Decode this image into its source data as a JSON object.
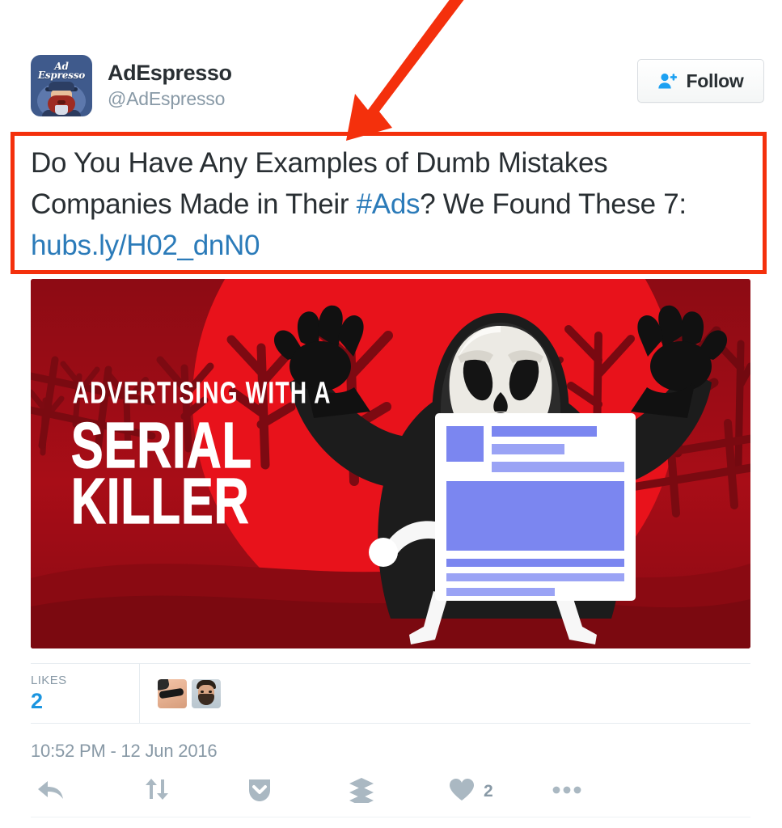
{
  "account": {
    "display_name": "AdEspresso",
    "handle": "@AdEspresso",
    "avatar_line1": "Ad",
    "avatar_line2": "Espresso",
    "avatar_alt": "adespresso-logo-barista"
  },
  "follow_button": {
    "label": "Follow",
    "icon": "user-plus-icon"
  },
  "tweet": {
    "text_part1": "Do You Have Any Examples of Dumb Mistakes Companies Made in Their ",
    "hashtag": "#Ads",
    "text_part2": "? We Found These 7: ",
    "link": "hubs.ly/H02_dnN0",
    "full_text": "Do You Have Any Examples of Dumb Mistakes Companies Made in Their #Ads? We Found These 7: hubs.ly/H02_dnN0",
    "timestamp": "10:52 PM - 12 Jun 2016"
  },
  "media": {
    "headline_small": "ADVERTISING WITH A",
    "headline_line1": "SERIAL",
    "headline_line2": "KILLER",
    "alt": "ghost-face-killer-holding-facebook-ad-card",
    "bg_color": "#a80d17",
    "accent_red": "#e8121b",
    "card_blue": "#7b86f0"
  },
  "likes": {
    "label": "LIKES",
    "count": "2",
    "liker_avatars": [
      "liker-avatar-1",
      "liker-avatar-2"
    ]
  },
  "actions": {
    "reply": "reply-icon",
    "retweet": "retweet-icon",
    "pocket": "pocket-save-icon",
    "buffer": "buffer-icon",
    "like": "like-heart-icon",
    "like_count": "2",
    "more": "more-options-icon"
  },
  "annotation": {
    "box_color": "#f4300c",
    "arrow_color": "#f4300c",
    "box_name": "red-highlight-box",
    "arrow_name": "red-pointer-arrow"
  },
  "colors": {
    "text": "#292f33",
    "muted": "#8899a6",
    "link": "#2b7bb9",
    "accent_blue": "#1b95e0",
    "border": "#e6ecf0"
  }
}
